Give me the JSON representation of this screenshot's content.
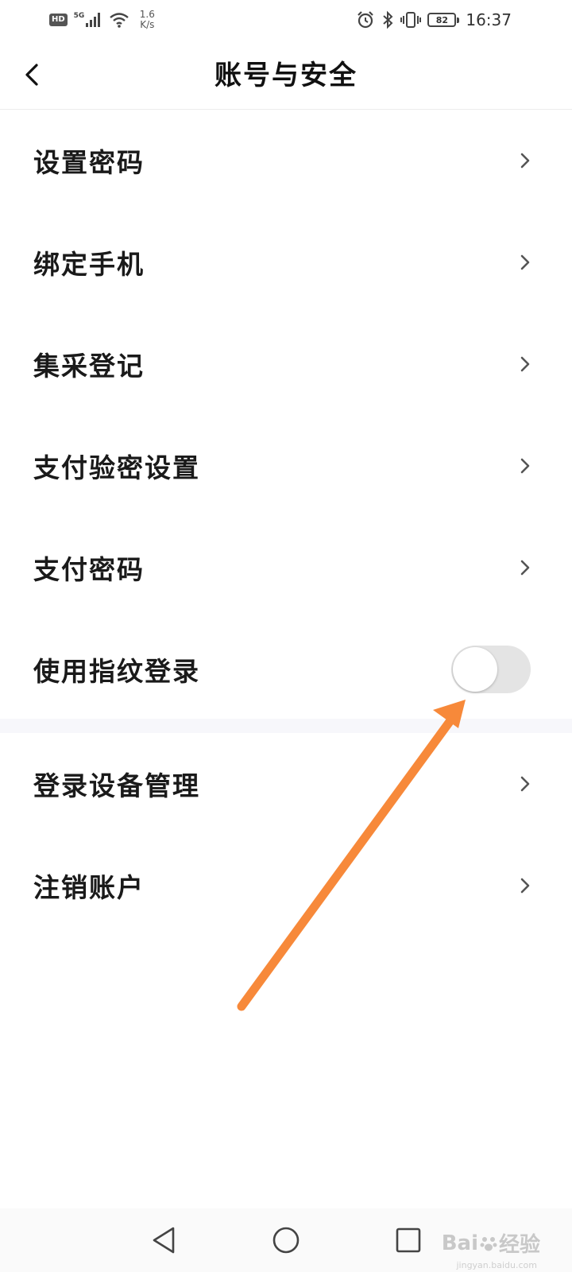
{
  "status_bar": {
    "hd": "HD",
    "network": "5G",
    "speed_value": "1.6",
    "speed_unit": "K/s",
    "battery": "82",
    "time": "16:37"
  },
  "header": {
    "title": "账号与安全"
  },
  "menu": {
    "group1": [
      {
        "label": "设置密码"
      },
      {
        "label": "绑定手机"
      },
      {
        "label": "集采登记"
      },
      {
        "label": "支付验密设置"
      },
      {
        "label": "支付密码"
      }
    ],
    "fingerprint": {
      "label": "使用指纹登录",
      "enabled": false
    },
    "group2": [
      {
        "label": "登录设备管理"
      },
      {
        "label": "注销账户"
      }
    ]
  },
  "watermark": {
    "brand": "Bai",
    "brand_suffix": "经验",
    "url": "jingyan.baidu.com"
  },
  "colors": {
    "annotation_arrow": "#f7893a",
    "toggle_off": "#e4e4e4",
    "section_gap": "#f7f7fb"
  }
}
